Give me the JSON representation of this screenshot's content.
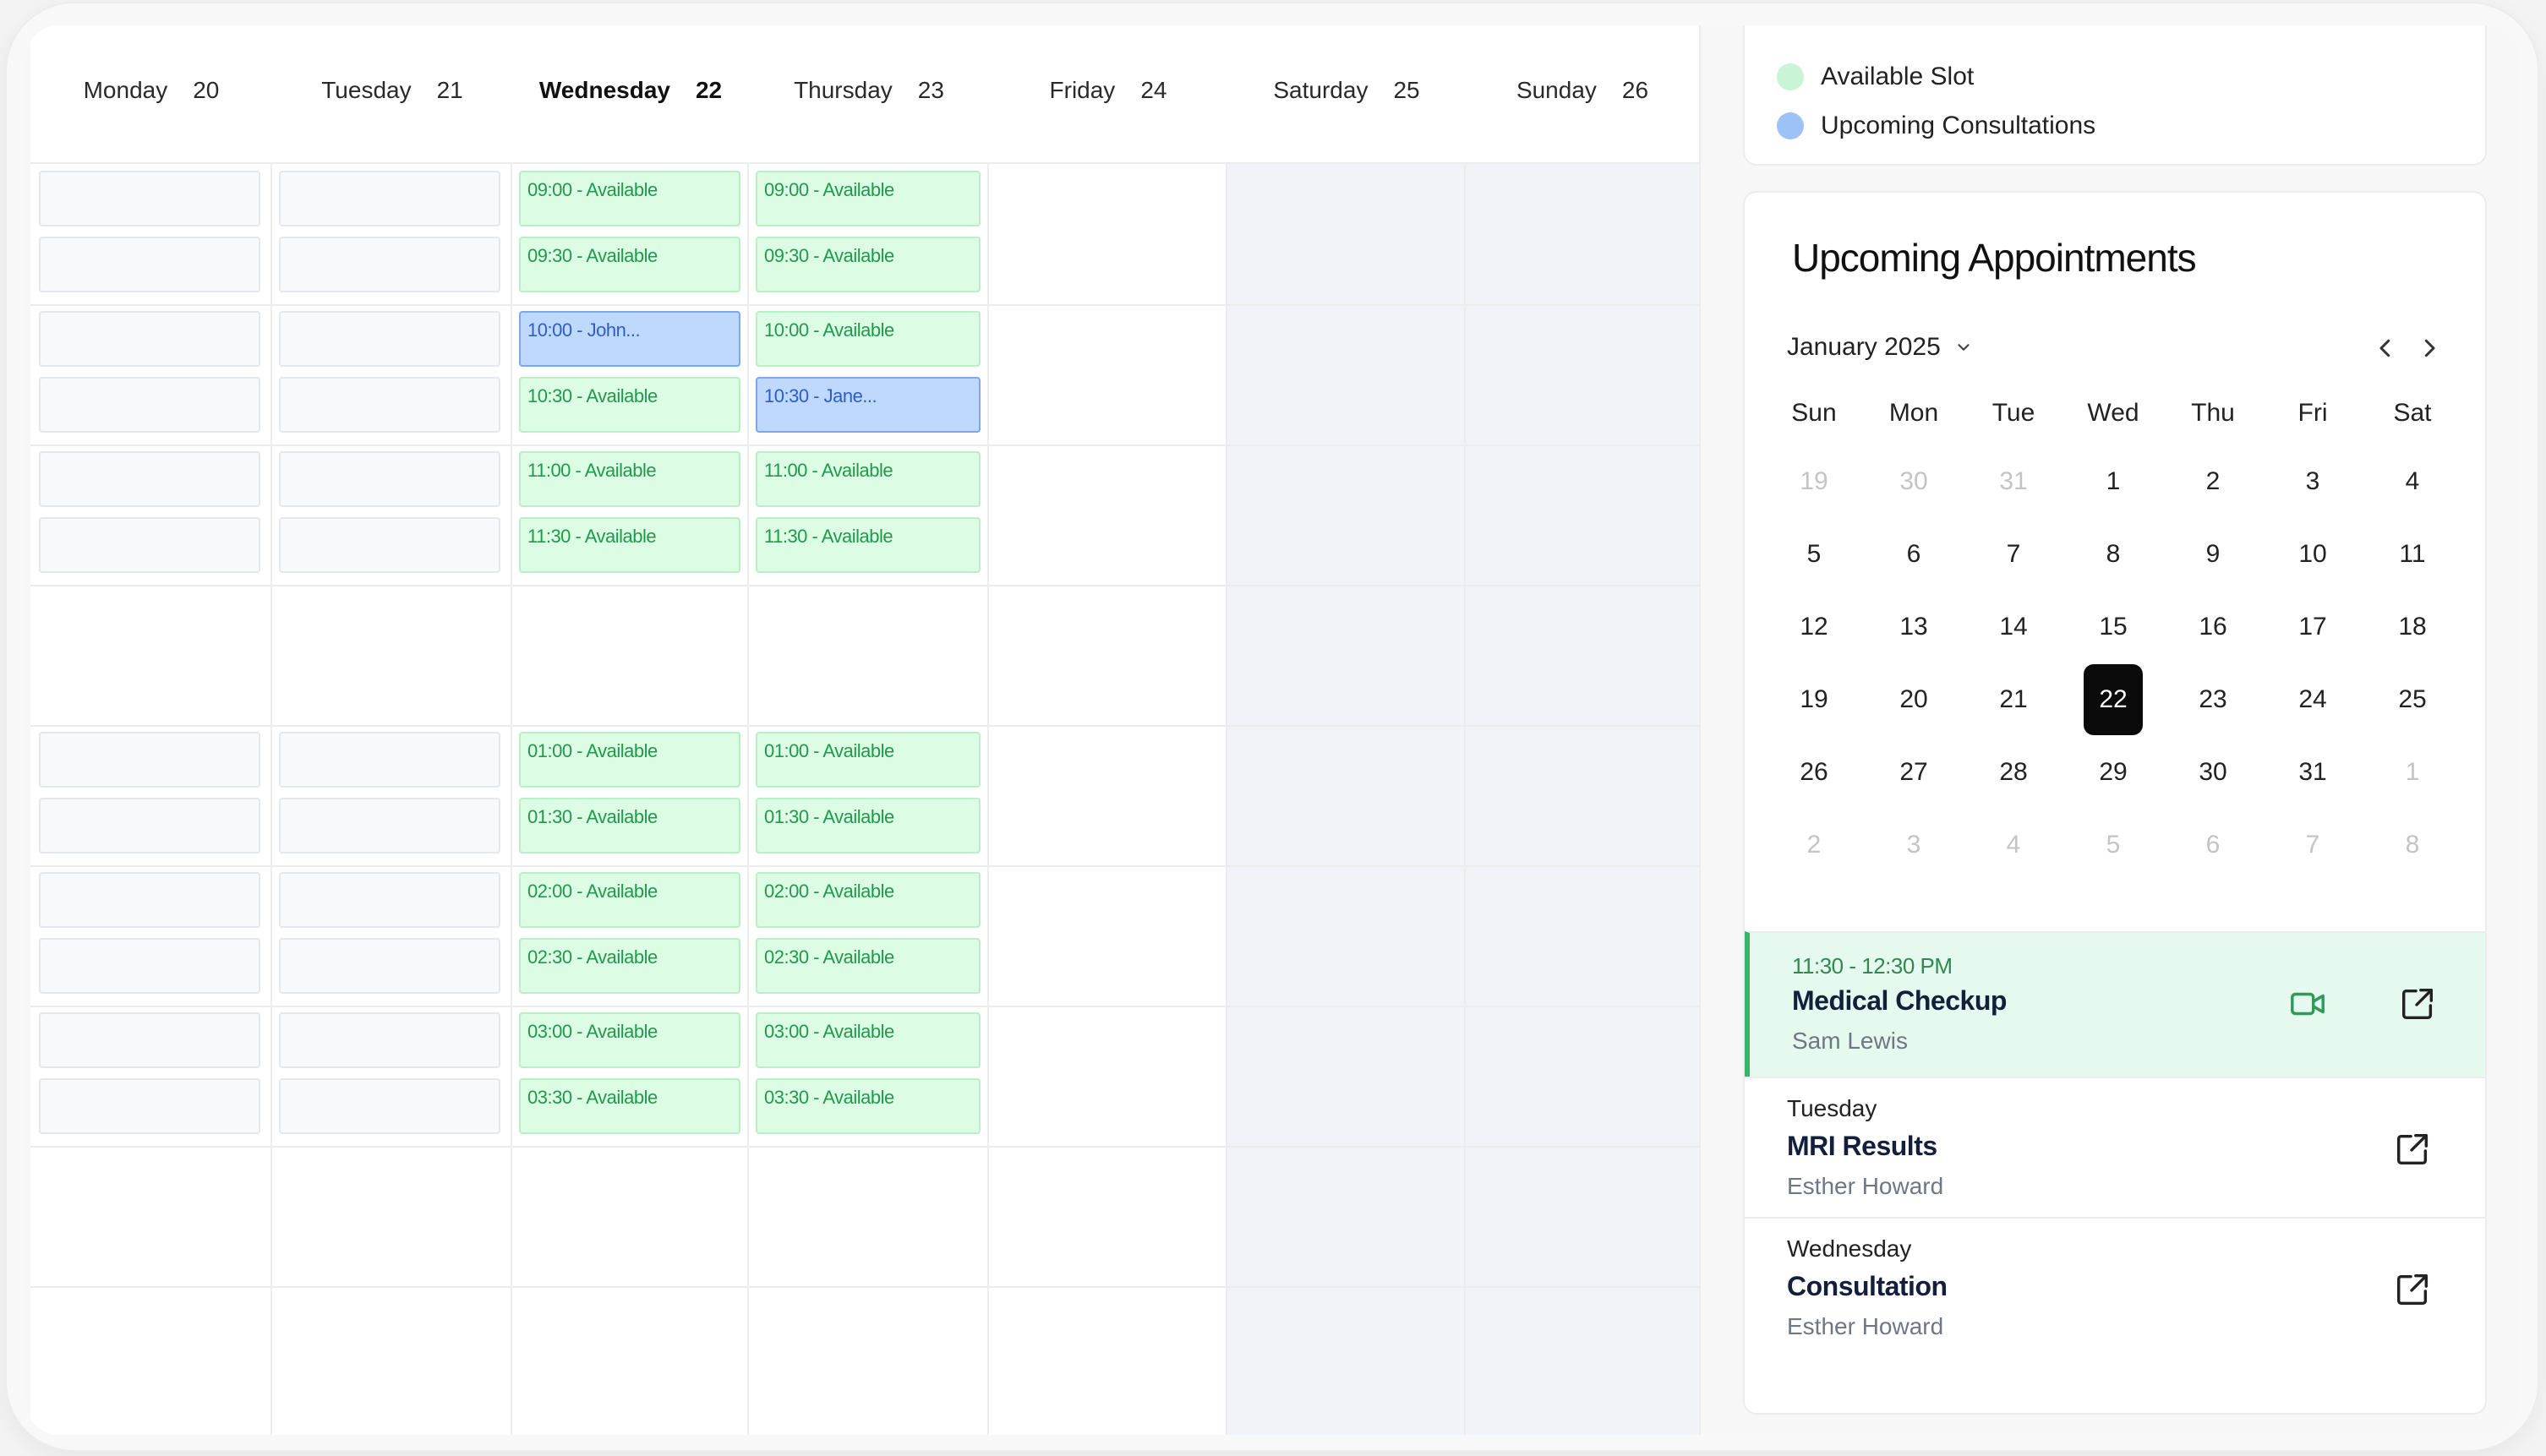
{
  "week": {
    "days": [
      {
        "name": "Monday",
        "date": "20"
      },
      {
        "name": "Tuesday",
        "date": "21"
      },
      {
        "name": "Wednesday",
        "date": "22"
      },
      {
        "name": "Thursday",
        "date": "23"
      },
      {
        "name": "Friday",
        "date": "24"
      },
      {
        "name": "Saturday",
        "date": "25"
      },
      {
        "name": "Sunday",
        "date": "26"
      }
    ],
    "wednesday_slots": [
      "09:00 - Available",
      "09:30 - Available",
      "10:00 - John...",
      "10:30 - Available",
      "11:00 - Available",
      "11:30 - Available",
      "01:00 - Available",
      "01:30 - Available",
      "02:00 - Available",
      "02:30 - Available",
      "03:00 - Available",
      "03:30 - Available"
    ],
    "thursday_slots": [
      "09:00 - Available",
      "09:30 - Available",
      "10:00 - Available",
      "10:30 - Jane...",
      "11:00 - Available",
      "11:30 - Available",
      "01:00 - Available",
      "01:30 - Available",
      "02:00 - Available",
      "02:30 - Available",
      "03:00 - Available",
      "03:30 - Available"
    ]
  },
  "legend": {
    "available": "Available Slot",
    "upcoming": "Upcoming Consultations",
    "colors": {
      "available": "#c9f4d6",
      "upcoming": "#9cc2f7"
    }
  },
  "appointments_panel": {
    "title": "Upcoming Appointments",
    "month": "January 2025",
    "weekdays": [
      "Sun",
      "Mon",
      "Tue",
      "Wed",
      "Thu",
      "Fri",
      "Sat"
    ],
    "weeks": [
      [
        "19",
        "30",
        "31",
        "1",
        "2",
        "3",
        "4"
      ],
      [
        "5",
        "6",
        "7",
        "8",
        "9",
        "10",
        "11"
      ],
      [
        "12",
        "13",
        "14",
        "15",
        "16",
        "17",
        "18"
      ],
      [
        "19",
        "20",
        "21",
        "22",
        "23",
        "24",
        "25"
      ],
      [
        "26",
        "27",
        "28",
        "29",
        "30",
        "31",
        "1"
      ],
      [
        "2",
        "3",
        "4",
        "5",
        "6",
        "7",
        "8"
      ]
    ],
    "selected_date": "22",
    "items": [
      {
        "when": "11:30 - 12:30 PM",
        "title": "Medical Checkup",
        "person": "Sam Lewis",
        "video": true
      },
      {
        "when": "Tuesday",
        "title": "MRI Results",
        "person": "Esther Howard",
        "video": false
      },
      {
        "when": "Wednesday",
        "title": "Consultation",
        "person": "Esther Howard",
        "video": false
      }
    ]
  }
}
